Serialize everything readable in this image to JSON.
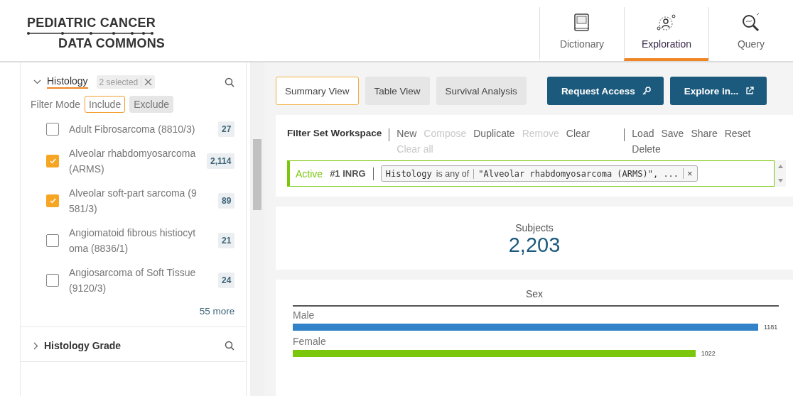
{
  "logo": {
    "line_1": "PEDIATRIC CANCER",
    "line_2": "DATA COMMONS"
  },
  "nav_tabs": [
    {
      "label": "Dictionary",
      "selected": false
    },
    {
      "label": "Exploration",
      "selected": true
    },
    {
      "label": "Query",
      "selected": false
    }
  ],
  "sidebar": {
    "facets": [
      {
        "title": "Histology",
        "expanded": true,
        "selected_count": "2 selected",
        "filter_mode": {
          "label": "Filter Mode",
          "options": [
            {
              "label": "Include",
              "selected": true
            },
            {
              "label": "Exclude",
              "selected": false
            }
          ]
        },
        "options": [
          {
            "label": "Adult Fibrosarcoma (8810/3)",
            "count": "27",
            "checked": false
          },
          {
            "label": "Alveolar rhabdomyosarcoma (ARMS)",
            "count": "2,114",
            "checked": true
          },
          {
            "label": "Alveolar soft-part sarcoma (9581/3)",
            "count": "89",
            "checked": true
          },
          {
            "label": "Angiomatoid fibrous histiocytoma (8836/1)",
            "count": "21",
            "checked": false
          },
          {
            "label": "Angiosarcoma of Soft Tissue (9120/3)",
            "count": "24",
            "checked": false
          }
        ],
        "more": "55 more"
      },
      {
        "title": "Histology Grade",
        "expanded": false
      }
    ]
  },
  "view_tabs": [
    {
      "label": "Summary View",
      "selected": true
    },
    {
      "label": "Table View",
      "selected": false
    },
    {
      "label": "Survival Analysis",
      "selected": false
    }
  ],
  "action_buttons": [
    {
      "label": "Request Access"
    },
    {
      "label": "Explore in..."
    }
  ],
  "workspace": {
    "title": "Filter Set Workspace",
    "action_groups": [
      [
        {
          "label": "New",
          "disabled": false
        },
        {
          "label": "Compose",
          "disabled": true
        },
        {
          "label": "Duplicate",
          "disabled": false
        },
        {
          "label": "Remove",
          "disabled": true
        },
        {
          "label": "Clear",
          "disabled": false
        },
        {
          "label": "Clear all",
          "disabled": true
        }
      ],
      [
        {
          "label": "Load",
          "disabled": false
        },
        {
          "label": "Save",
          "disabled": false
        },
        {
          "label": "Share",
          "disabled": false
        },
        {
          "label": "Reset",
          "disabled": false
        },
        {
          "label": "Delete",
          "disabled": false
        }
      ]
    ],
    "active_set": {
      "status": "Active",
      "name": "#1 INRG",
      "filter": {
        "field": "Histology",
        "operator": "is any of",
        "value": "\"Alveolar rhabdomyosarcoma (ARMS)\", ...",
        "remove": "×"
      }
    }
  },
  "subjects": {
    "label": "Subjects",
    "value": "2,203"
  },
  "sex_chart": {
    "chart_data": {
      "type": "bar",
      "orientation": "horizontal",
      "title": "Sex",
      "data_labels": true,
      "categories": [
        "Male",
        "Female"
      ],
      "values": [
        1181,
        1022
      ],
      "colors": [
        "#3182c8",
        "#7ac70c"
      ]
    }
  }
}
